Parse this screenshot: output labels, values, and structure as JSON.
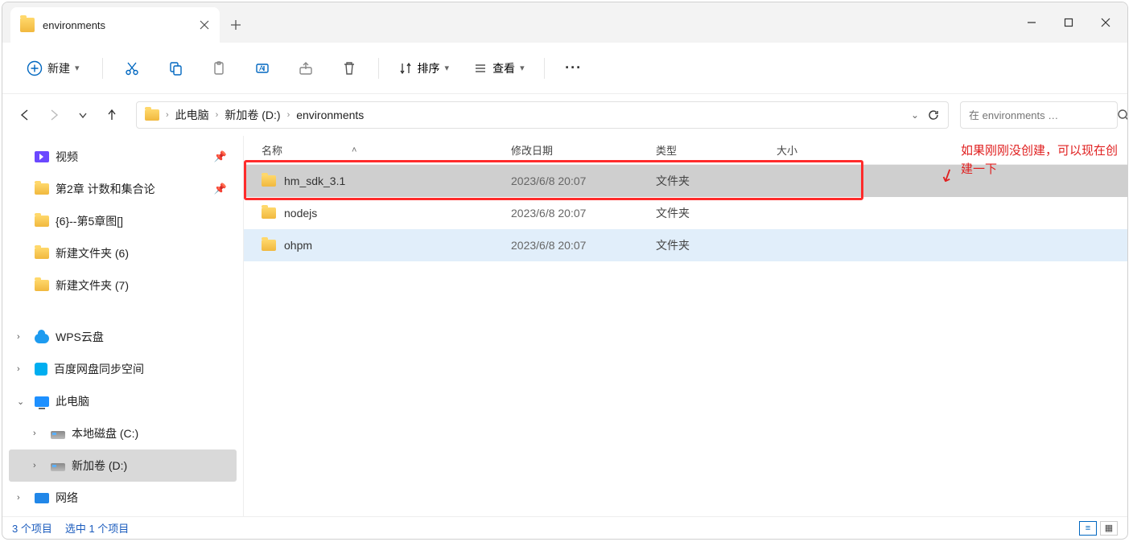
{
  "tab": {
    "title": "environments"
  },
  "toolbar": {
    "new_label": "新建",
    "sort_label": "排序",
    "view_label": "查看"
  },
  "breadcrumb": {
    "items": [
      "此电脑",
      "新加卷 (D:)",
      "environments"
    ]
  },
  "search": {
    "placeholder": "在 environments …"
  },
  "sidebar": {
    "quick": [
      {
        "label": "视频",
        "icon": "video",
        "pinned": true
      },
      {
        "label": "第2章 计数和集合论",
        "icon": "folder",
        "pinned": true
      },
      {
        "label": "{6}--第5章图[]",
        "icon": "folder",
        "pinned": false
      },
      {
        "label": "新建文件夹 (6)",
        "icon": "folder",
        "pinned": false
      },
      {
        "label": "新建文件夹 (7)",
        "icon": "folder",
        "pinned": false
      }
    ],
    "cloud": [
      {
        "label": "WPS云盘",
        "icon": "cloud"
      },
      {
        "label": "百度网盘同步空间",
        "icon": "sync"
      }
    ],
    "thispc": {
      "label": "此电脑"
    },
    "drives": [
      {
        "label": "本地磁盘 (C:)"
      },
      {
        "label": "新加卷 (D:)",
        "selected": true
      }
    ],
    "network": {
      "label": "网络"
    }
  },
  "columns": {
    "name": "名称",
    "date": "修改日期",
    "type": "类型",
    "size": "大小"
  },
  "files": [
    {
      "name": "hm_sdk_3.1",
      "date": "2023/6/8 20:07",
      "type": "文件夹",
      "size": "",
      "state": "selected"
    },
    {
      "name": "nodejs",
      "date": "2023/6/8 20:07",
      "type": "文件夹",
      "size": "",
      "state": ""
    },
    {
      "name": "ohpm",
      "date": "2023/6/8 20:07",
      "type": "文件夹",
      "size": "",
      "state": "hover"
    }
  ],
  "status": {
    "count": "3 个项目",
    "selected": "选中 1 个项目"
  },
  "annotation": {
    "text1": "如果刚刚没创建，可以现在创",
    "text2": "建一下"
  }
}
